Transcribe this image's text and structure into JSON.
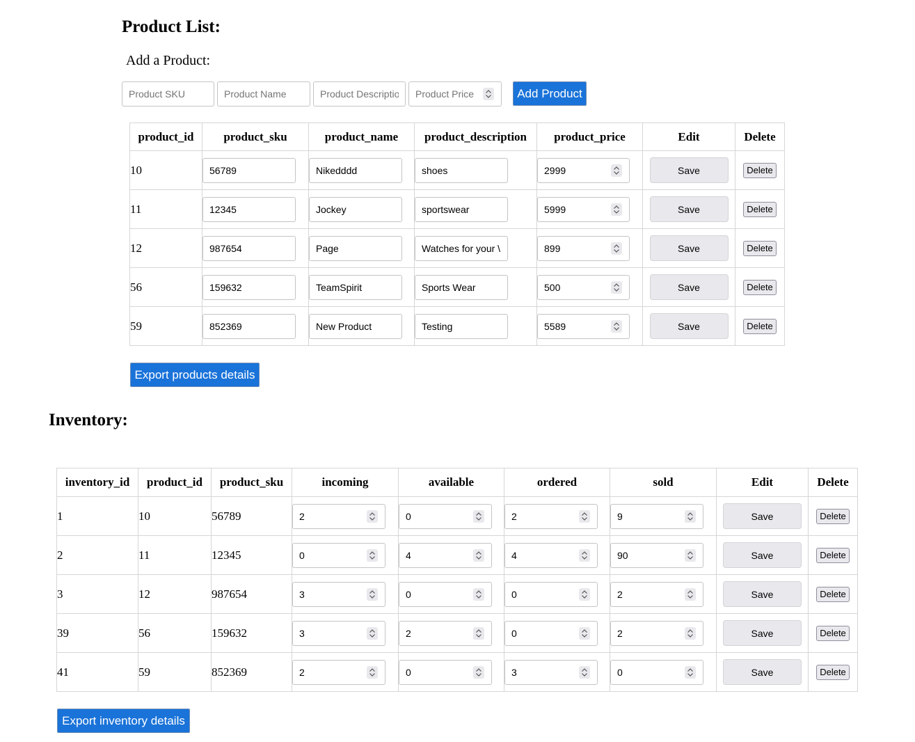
{
  "products": {
    "heading": "Product List:",
    "add_label": "Add a Product:",
    "form": {
      "sku_placeholder": "Product SKU",
      "name_placeholder": "Product Name",
      "description_placeholder": "Product Descriptio",
      "price_placeholder": "Product Price",
      "add_button": "Add Product"
    },
    "columns": [
      "product_id",
      "product_sku",
      "product_name",
      "product_description",
      "product_price",
      "Edit",
      "Delete"
    ],
    "rows": [
      {
        "id": "10",
        "sku": "56789",
        "name": "Nikedddd",
        "description": "shoes",
        "price": "2999"
      },
      {
        "id": "11",
        "sku": "12345",
        "name": "Jockey",
        "description": "sportswear",
        "price": "5999"
      },
      {
        "id": "12",
        "sku": "987654",
        "name": "Page",
        "description": "Watches for your \\",
        "price": "899"
      },
      {
        "id": "56",
        "sku": "159632",
        "name": "TeamSpirit",
        "description": "Sports Wear",
        "price": "500"
      },
      {
        "id": "59",
        "sku": "852369",
        "name": "New Product",
        "description": "Testing",
        "price": "5589"
      }
    ],
    "save_label": "Save",
    "delete_label": "Delete",
    "export_button": "Export products details"
  },
  "inventory": {
    "heading": "Inventory:",
    "columns": [
      "inventory_id",
      "product_id",
      "product_sku",
      "incoming",
      "available",
      "ordered",
      "sold",
      "Edit",
      "Delete"
    ],
    "rows": [
      {
        "inventory_id": "1",
        "product_id": "10",
        "sku": "56789",
        "incoming": "2",
        "available": "0",
        "ordered": "2",
        "sold": "9"
      },
      {
        "inventory_id": "2",
        "product_id": "11",
        "sku": "12345",
        "incoming": "0",
        "available": "4",
        "ordered": "4",
        "sold": "90"
      },
      {
        "inventory_id": "3",
        "product_id": "12",
        "sku": "987654",
        "incoming": "3",
        "available": "0",
        "ordered": "0",
        "sold": "2"
      },
      {
        "inventory_id": "39",
        "product_id": "56",
        "sku": "159632",
        "incoming": "3",
        "available": "2",
        "ordered": "0",
        "sold": "2"
      },
      {
        "inventory_id": "41",
        "product_id": "59",
        "sku": "852369",
        "incoming": "2",
        "available": "0",
        "ordered": "3",
        "sold": "0"
      }
    ],
    "save_label": "Save",
    "delete_label": "Delete",
    "export_button": "Export inventory details"
  }
}
